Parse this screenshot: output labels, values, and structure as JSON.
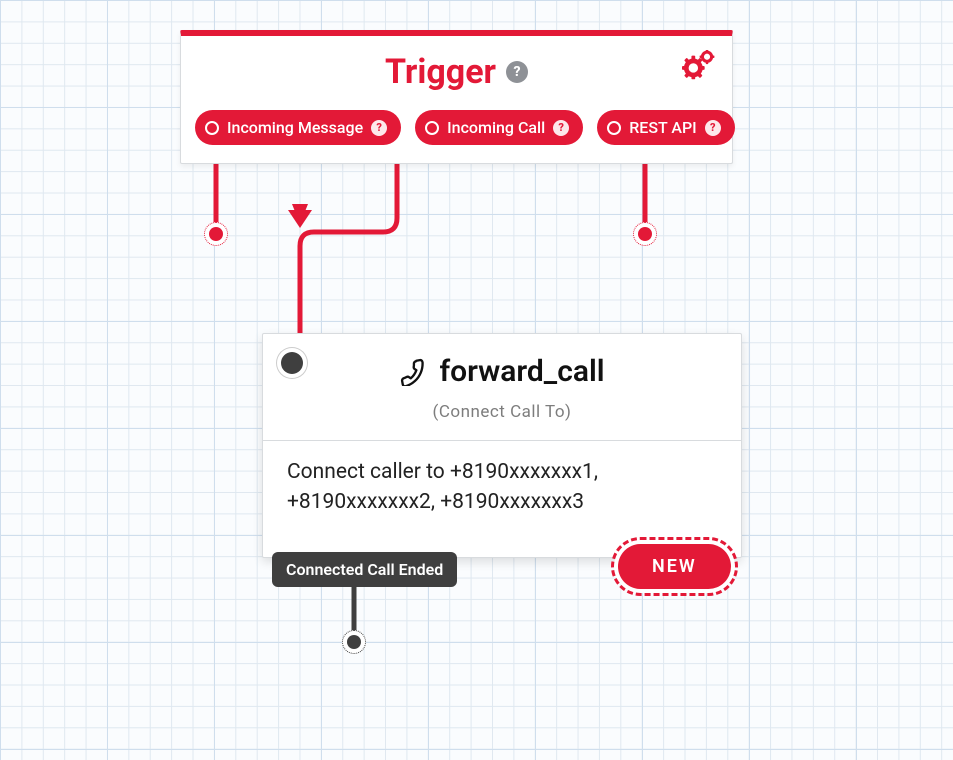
{
  "trigger": {
    "title": "Trigger",
    "pills": [
      {
        "label": "Incoming Message"
      },
      {
        "label": "Incoming Call"
      },
      {
        "label": "REST API"
      }
    ]
  },
  "widget": {
    "name": "forward_call",
    "subtitle": "(Connect Call To)",
    "body": "Connect caller to +8190xxxxxxx1, +8190xxxxxxx2, +8190xxxxxxx3",
    "outports": {
      "ended": "Connected Call Ended",
      "new": "NEW"
    }
  },
  "icons": {
    "help": "?",
    "gears": "gears",
    "phone": "phone"
  }
}
